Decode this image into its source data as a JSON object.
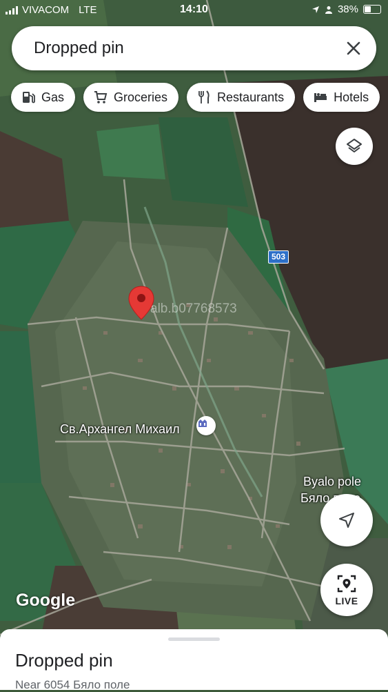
{
  "status_bar": {
    "carrier": "VIVACOM",
    "network": "LTE",
    "time": "14:10",
    "battery": "38%",
    "battery_level": 0.38
  },
  "search": {
    "value": "Dropped pin",
    "close_icon": "close-icon"
  },
  "chips": [
    {
      "label": "Gas",
      "icon": "gas-station-icon"
    },
    {
      "label": "Groceries",
      "icon": "cart-icon"
    },
    {
      "label": "Restaurants",
      "icon": "fork-knife-icon"
    },
    {
      "label": "Hotels",
      "icon": "bed-icon"
    }
  ],
  "map": {
    "road_shield": "503",
    "watermark": "alb.b07768573",
    "poi_label": "Св.Архангел Михаил",
    "town_label_latin": "Byalo pole",
    "town_label_cyrillic": "Бяло поле",
    "attribution": "Google",
    "pin_color": "#e53935",
    "road_shield_color": "#2c6fc8"
  },
  "buttons": {
    "layers_icon": "layers-icon",
    "navigate_icon": "navigation-arrow-icon",
    "live_label": "LIVE"
  },
  "bottom_sheet": {
    "title": "Dropped pin",
    "subtitle": "Near 6054 Бяло поле"
  }
}
